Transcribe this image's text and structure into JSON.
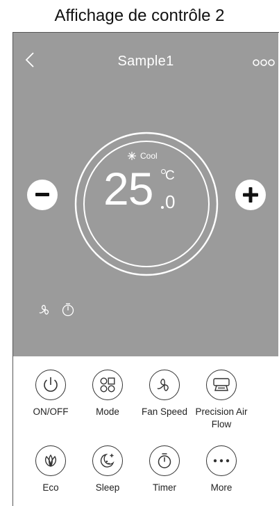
{
  "caption": "Affichage de contrôle 2",
  "header": {
    "title": "Sample1",
    "back_icon": "chevron-left-icon",
    "more_icon": "more-dots-icon"
  },
  "thermostat": {
    "mode_label": "Cool",
    "mode_icon": "snowflake-icon",
    "temperature": "25",
    "unit": "C",
    "decimal": "0"
  },
  "status_icons": [
    "fan-icon",
    "timer-icon"
  ],
  "controls": [
    {
      "label": "ON/OFF",
      "icon": "power-icon"
    },
    {
      "label": "Mode",
      "icon": "mode-grid-icon"
    },
    {
      "label": "Fan Speed",
      "icon": "fan-icon"
    },
    {
      "label": "Precision Air Flow",
      "icon": "air-flow-icon"
    },
    {
      "label": "Eco",
      "icon": "leaf-icon"
    },
    {
      "label": "Sleep",
      "icon": "moon-icon"
    },
    {
      "label": "Timer",
      "icon": "timer-icon"
    },
    {
      "label": "More",
      "icon": "ellipsis-icon"
    }
  ],
  "colors": {
    "screen_background": "#9b9b9b",
    "foreground": "#ffffff",
    "control_stroke": "#333333"
  }
}
